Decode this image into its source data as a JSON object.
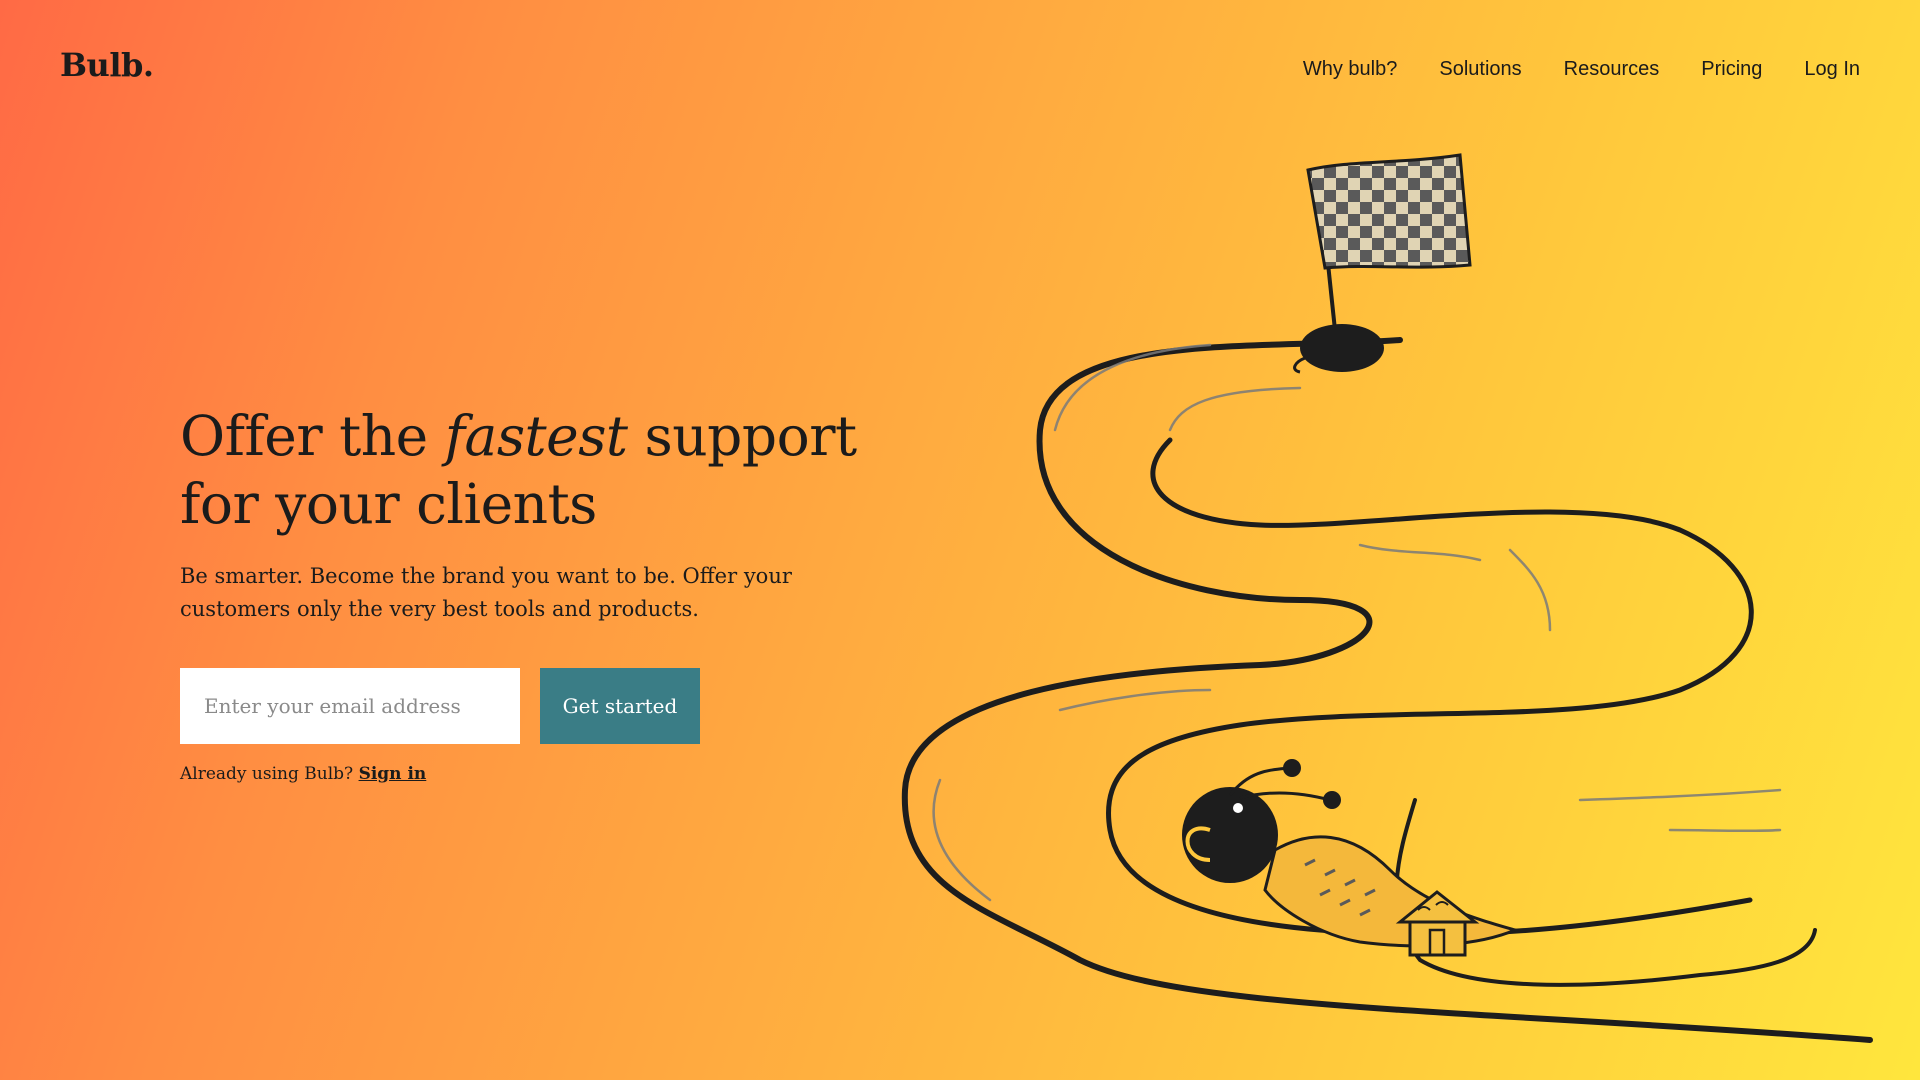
{
  "brand": {
    "logo": "Bulb."
  },
  "nav": {
    "items": [
      {
        "label": "Why bulb?"
      },
      {
        "label": "Solutions"
      },
      {
        "label": "Resources"
      },
      {
        "label": "Pricing"
      },
      {
        "label": "Log In"
      }
    ]
  },
  "hero": {
    "title_pre": "Offer the ",
    "title_em": "fastest",
    "title_post": " support for your clients",
    "subtitle": "Be smarter. Become the brand you want to be. Offer your customers only the very best tools and products.",
    "email_placeholder": "Enter your email address",
    "email_value": "",
    "cta_label": "Get started",
    "signin_prefix": "Already using Bulb?",
    "signin_link": "Sign in"
  },
  "illustration": {
    "icons": [
      "checkered-flag-icon",
      "snail-icon",
      "house-icon"
    ]
  },
  "colors": {
    "gradient_start": "#ff6a45",
    "gradient_end": "#ffe63d",
    "cta_background": "#3a7d86",
    "text": "#1b1b1b"
  }
}
